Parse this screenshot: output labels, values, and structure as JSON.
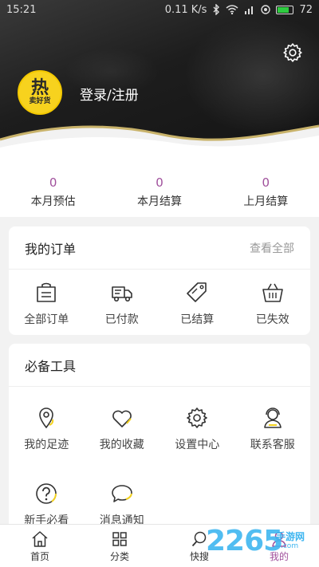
{
  "status_bar": {
    "time": "15:21",
    "speed": "0.11 K/s",
    "battery": "72"
  },
  "profile": {
    "avatar_text_big": "热",
    "avatar_text_small": "卖好货",
    "login_label": "登录/注册"
  },
  "stats": [
    {
      "value": "0",
      "label": "本月预估"
    },
    {
      "value": "0",
      "label": "本月结算"
    },
    {
      "value": "0",
      "label": "上月结算"
    }
  ],
  "orders": {
    "title": "我的订单",
    "view_all": "查看全部",
    "items": [
      {
        "label": "全部订单",
        "icon": "shopping-bag-icon"
      },
      {
        "label": "已付款",
        "icon": "truck-icon"
      },
      {
        "label": "已结算",
        "icon": "tag-icon"
      },
      {
        "label": "已失效",
        "icon": "basket-icon"
      }
    ]
  },
  "tools": {
    "title": "必备工具",
    "items": [
      {
        "label": "我的足迹",
        "icon": "location-pin-icon"
      },
      {
        "label": "我的收藏",
        "icon": "heart-icon"
      },
      {
        "label": "设置中心",
        "icon": "gear-icon"
      },
      {
        "label": "联系客服",
        "icon": "customer-service-icon"
      },
      {
        "label": "新手必看",
        "icon": "question-icon"
      },
      {
        "label": "消息通知",
        "icon": "message-icon"
      }
    ]
  },
  "bottom_nav": [
    {
      "label": "首页",
      "icon": "home-icon"
    },
    {
      "label": "分类",
      "icon": "grid-icon"
    },
    {
      "label": "快搜",
      "icon": "search-icon"
    },
    {
      "label": "我的",
      "icon": "user-icon",
      "active": true
    }
  ],
  "watermark": {
    "text": "2265",
    "suffix": "手游网",
    "domain": ".com"
  },
  "colors": {
    "accent": "#a0509c",
    "avatar_yellow": "#f7d21e",
    "gold_wave": "#c8b26a"
  }
}
